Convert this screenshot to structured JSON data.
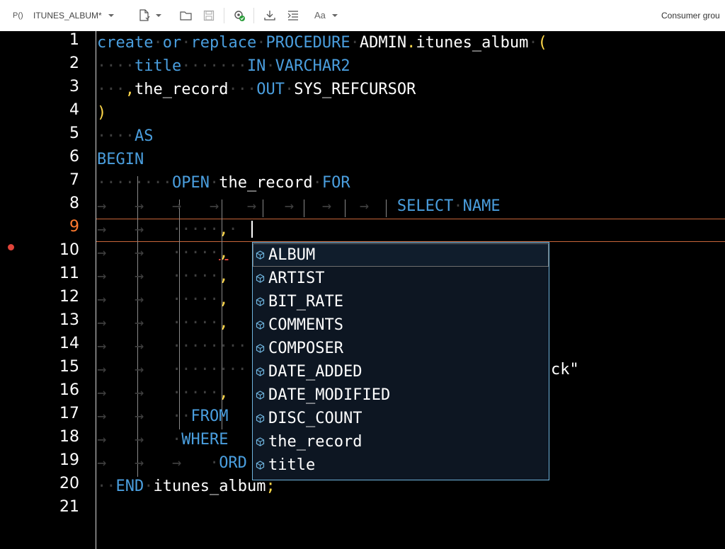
{
  "toolbar": {
    "procedure_prefix": "P()",
    "tab_name": "ITUNES_ALBUM*",
    "consumer_group": "Consumer grou"
  },
  "editor": {
    "line_numbers": [
      "1",
      "2",
      "3",
      "4",
      "5",
      "6",
      "7",
      "8",
      "9",
      "10",
      "11",
      "12",
      "13",
      "14",
      "15",
      "16",
      "17",
      "18",
      "19",
      "20",
      "21"
    ],
    "active_line": 9,
    "breakpoint_line": 10,
    "code": {
      "l1_create": "create",
      "l1_or": "or",
      "l1_replace": "replace",
      "l1_procedure": "PROCEDURE",
      "l1_name": "ADMIN",
      "l1_dot": ".",
      "l1_proc": "itunes_album",
      "l1_paren": "(",
      "l2_param": "title",
      "l2_in": "IN",
      "l2_type": "VARCHAR2",
      "l3_comma": ",",
      "l3_param": "the_record",
      "l3_out": "OUT",
      "l3_type": "SYS_REFCURSOR",
      "l4_paren": ")",
      "l5_as": "AS",
      "l6_begin": "BEGIN",
      "l7_open": "OPEN",
      "l7_cursor": "the_record",
      "l7_for": "FOR",
      "l8_select": "SELECT",
      "l8_name": "NAME",
      "comma": ",",
      "l15_tail": "ck\"",
      "l17_from": "FROM",
      "l18_where": "WHERE",
      "l19_ord": "ORD",
      "l20_end": "END",
      "l20_name": "itunes_album",
      "l20_semi": ";"
    }
  },
  "autocomplete": {
    "items": [
      "ALBUM",
      "ARTIST",
      "BIT_RATE",
      "COMMENTS",
      "COMPOSER",
      "DATE_ADDED",
      "DATE_MODIFIED",
      "DISC_COUNT",
      "the_record",
      "title"
    ],
    "selected": "ALBUM"
  },
  "colors": {
    "keyword": "#4a9ede",
    "punctuation": "#ffd84a",
    "active_line_number": "#ff7a2f",
    "breakpoint": "#e0443a",
    "popup_border": "#6fb5df"
  }
}
